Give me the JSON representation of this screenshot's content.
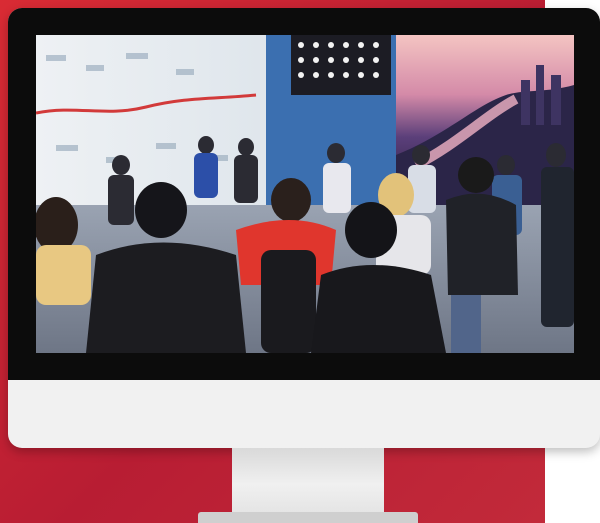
{
  "photo": {
    "description_icon": "crowd-exhibition-photo"
  },
  "colors": {
    "accent_red": "#c8242f",
    "bezel": "#0c0c0c",
    "monitor_frame": "#f1f1f1"
  }
}
